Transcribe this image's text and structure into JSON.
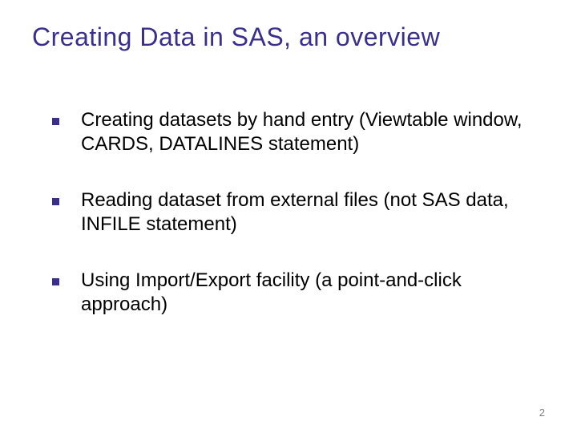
{
  "title": "Creating Data in SAS, an overview",
  "bullets": [
    "Creating datasets by hand entry (Viewtable window, CARDS, DATALINES statement)",
    "Reading dataset from external files (not SAS data, INFILE statement)",
    "Using Import/Export facility (a point-and-click approach)"
  ],
  "pageNumber": "2",
  "colors": {
    "accent": "#3a2f8a"
  }
}
